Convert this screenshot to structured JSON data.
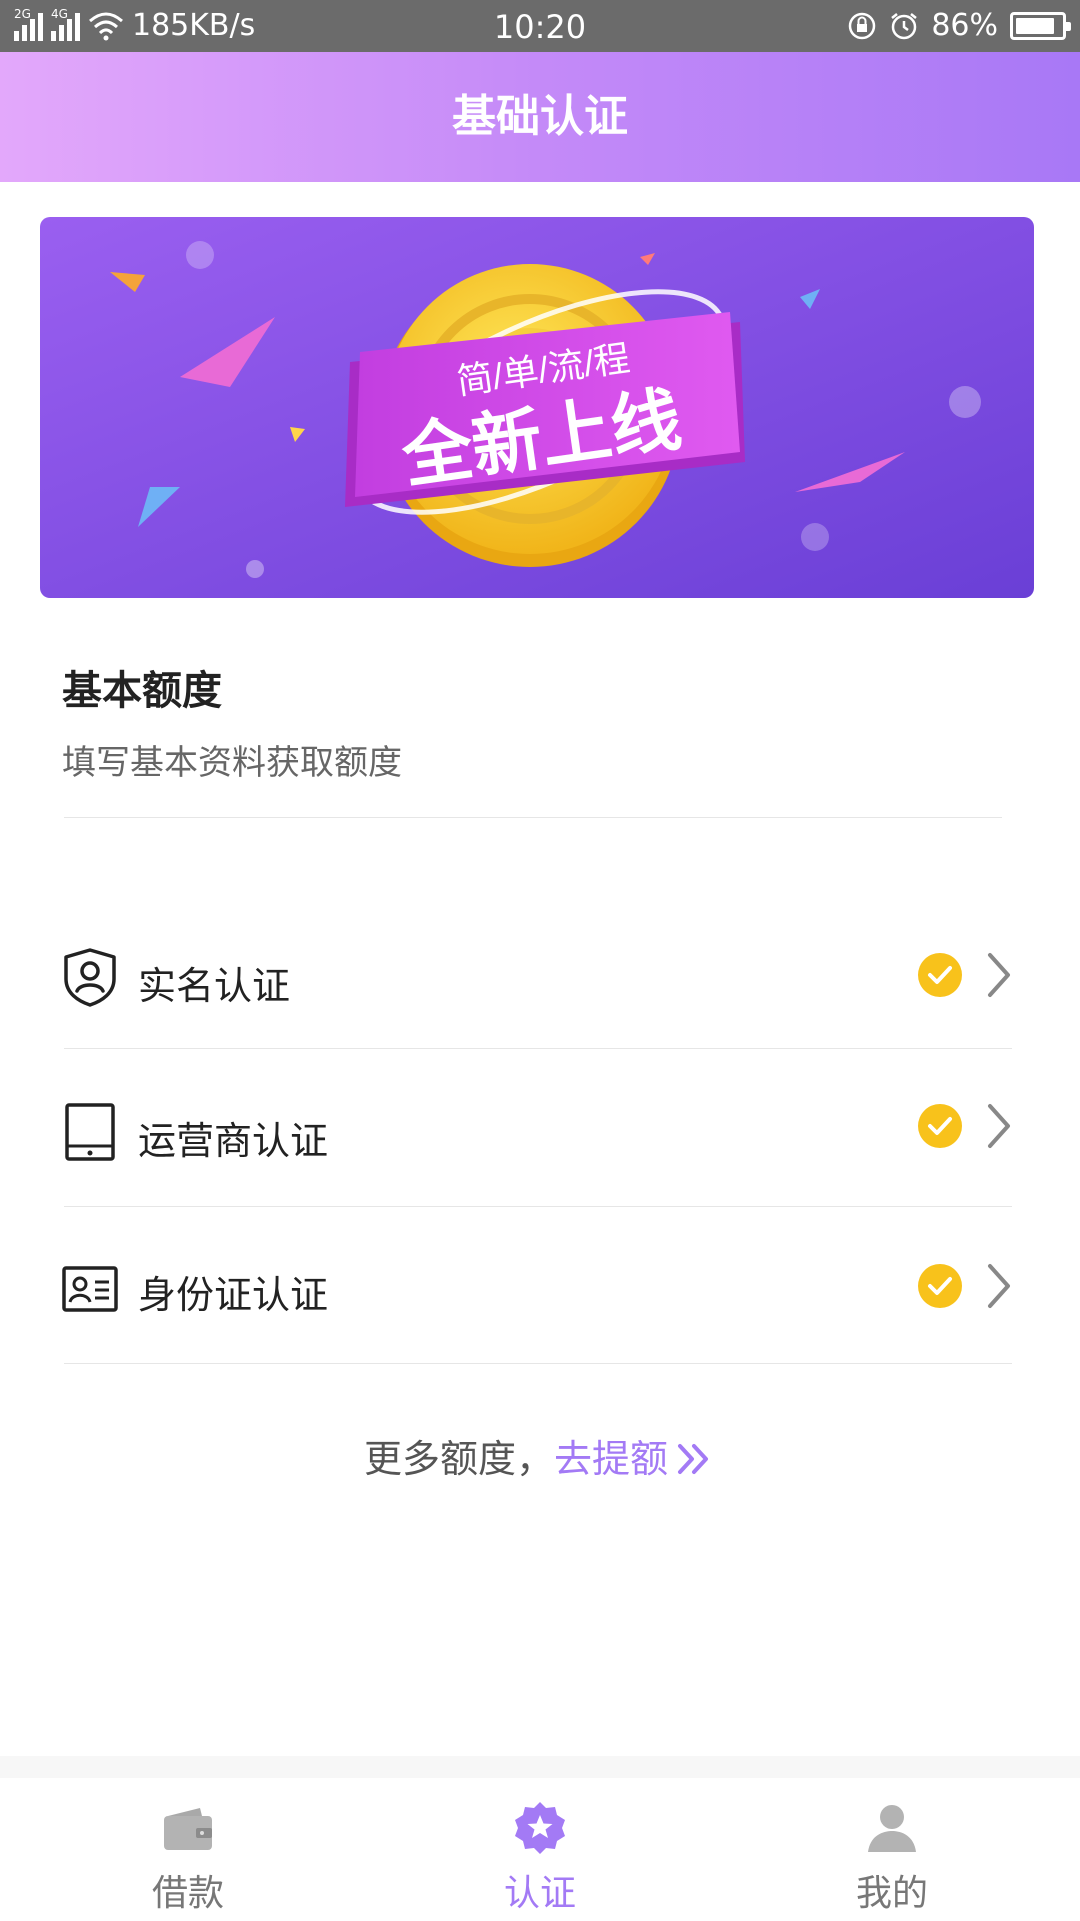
{
  "status_bar": {
    "network_left": "2G",
    "network_right": "4G",
    "speed": "185KB/s",
    "time": "10:20",
    "battery": "86%",
    "battery_level": 0.86
  },
  "header": {
    "title": "基础认证"
  },
  "banner": {
    "subtitle": "简/单/流/程",
    "headline": "全新上线"
  },
  "quota": {
    "title": "基本额度",
    "subtitle": "填写基本资料获取额度"
  },
  "auth_items": [
    {
      "label": "实名认证",
      "icon": "shield-user-icon",
      "status": "completed"
    },
    {
      "label": "运营商认证",
      "icon": "tablet-icon",
      "status": "completed"
    },
    {
      "label": "身份证认证",
      "icon": "id-card-icon",
      "status": "completed"
    }
  ],
  "more_quota": {
    "text": "更多额度，",
    "link": "去提额"
  },
  "tab_bar": {
    "tabs": [
      {
        "label": "借款",
        "icon": "wallet-icon",
        "active": false
      },
      {
        "label": "认证",
        "icon": "star-badge-icon",
        "active": true
      },
      {
        "label": "我的",
        "icon": "person-icon",
        "active": false
      }
    ]
  },
  "colors": {
    "accent": "#a37af5",
    "check": "#f8c21b",
    "header_start": "#e3a8fb",
    "header_end": "#a878f6"
  }
}
